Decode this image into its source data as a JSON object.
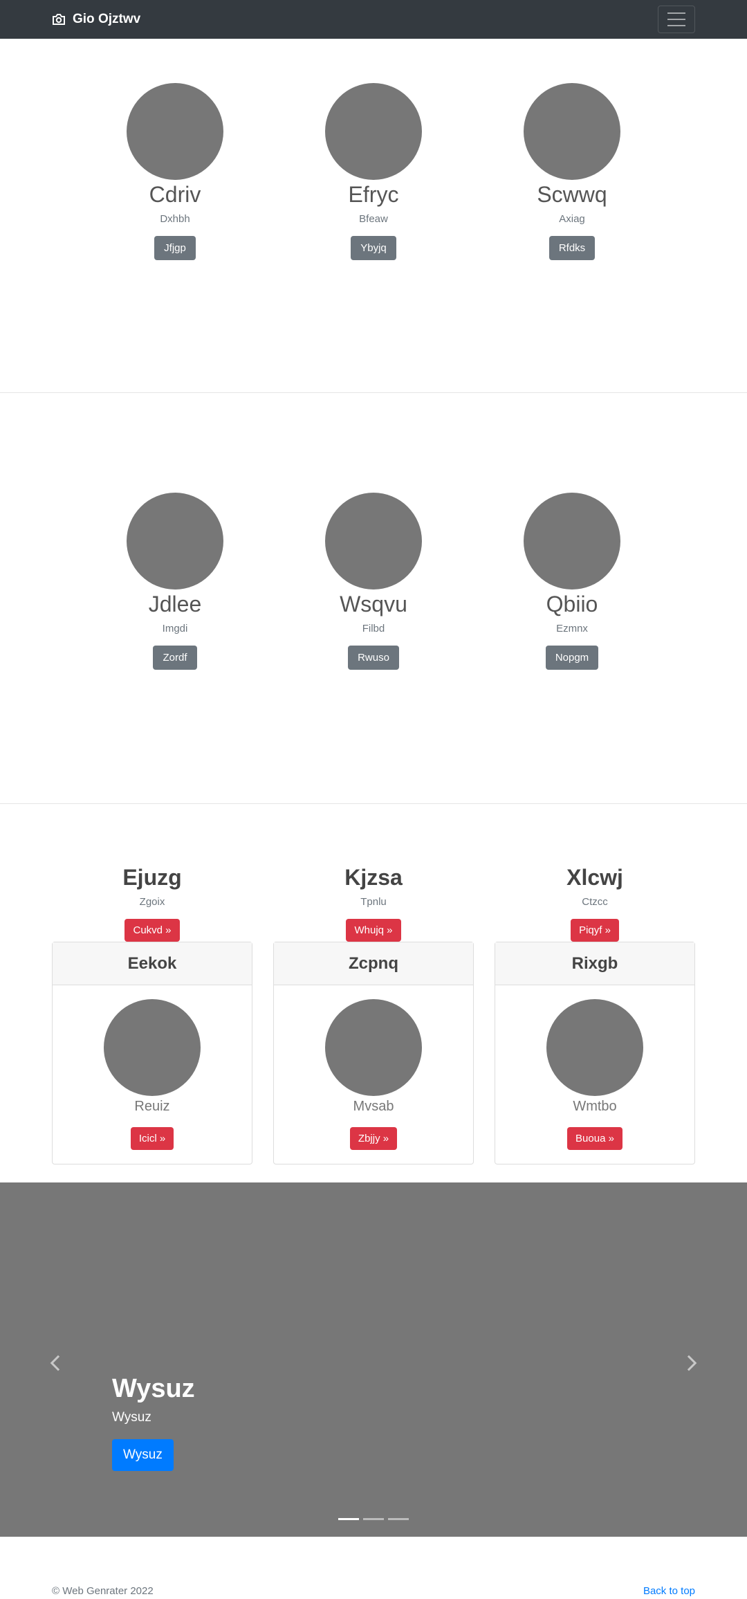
{
  "navbar": {
    "brand": "Gio Ojztwv"
  },
  "team1": [
    {
      "name": "Cdriv",
      "sub": "Dxhbh",
      "button": "Jfjgp"
    },
    {
      "name": "Efryc",
      "sub": "Bfeaw",
      "button": "Ybyjq"
    },
    {
      "name": "Scwwq",
      "sub": "Axiag",
      "button": "Rfdks"
    }
  ],
  "team2": [
    {
      "name": "Jdlee",
      "sub": "Imgdi",
      "button": "Zordf"
    },
    {
      "name": "Wsqvu",
      "sub": "Filbd",
      "button": "Rwuso"
    },
    {
      "name": "Qbiio",
      "sub": "Ezmnx",
      "button": "Nopgm"
    }
  ],
  "pricing": [
    {
      "title": "Ejuzg",
      "sub": "Zgoix",
      "button": "Cukvd »",
      "card_header": "Eekok",
      "card_name": "Reuiz",
      "card_button": "Icicl »"
    },
    {
      "title": "Kjzsa",
      "sub": "Tpnlu",
      "button": "Whujq »",
      "card_header": "Zcpnq",
      "card_name": "Mvsab",
      "card_button": "Zbjjy »"
    },
    {
      "title": "Xlcwj",
      "sub": "Ctzcc",
      "button": "Piqyf »",
      "card_header": "Rixgb",
      "card_name": "Wmtbo",
      "card_button": "Buoua »"
    }
  ],
  "carousel": {
    "title": "Wysuz",
    "subtitle": "Wysuz",
    "button": "Wysuz",
    "slides": 3,
    "active_slide": 1
  },
  "footer": {
    "copyright": "© Web Genrater 2022",
    "back_to_top": "Back to top"
  },
  "colors": {
    "navbar": "#343a40",
    "avatar": "#777777",
    "secondary": "#6c757d",
    "danger": "#dc3545",
    "primary": "#007bff",
    "carousel_bg": "#777777"
  }
}
